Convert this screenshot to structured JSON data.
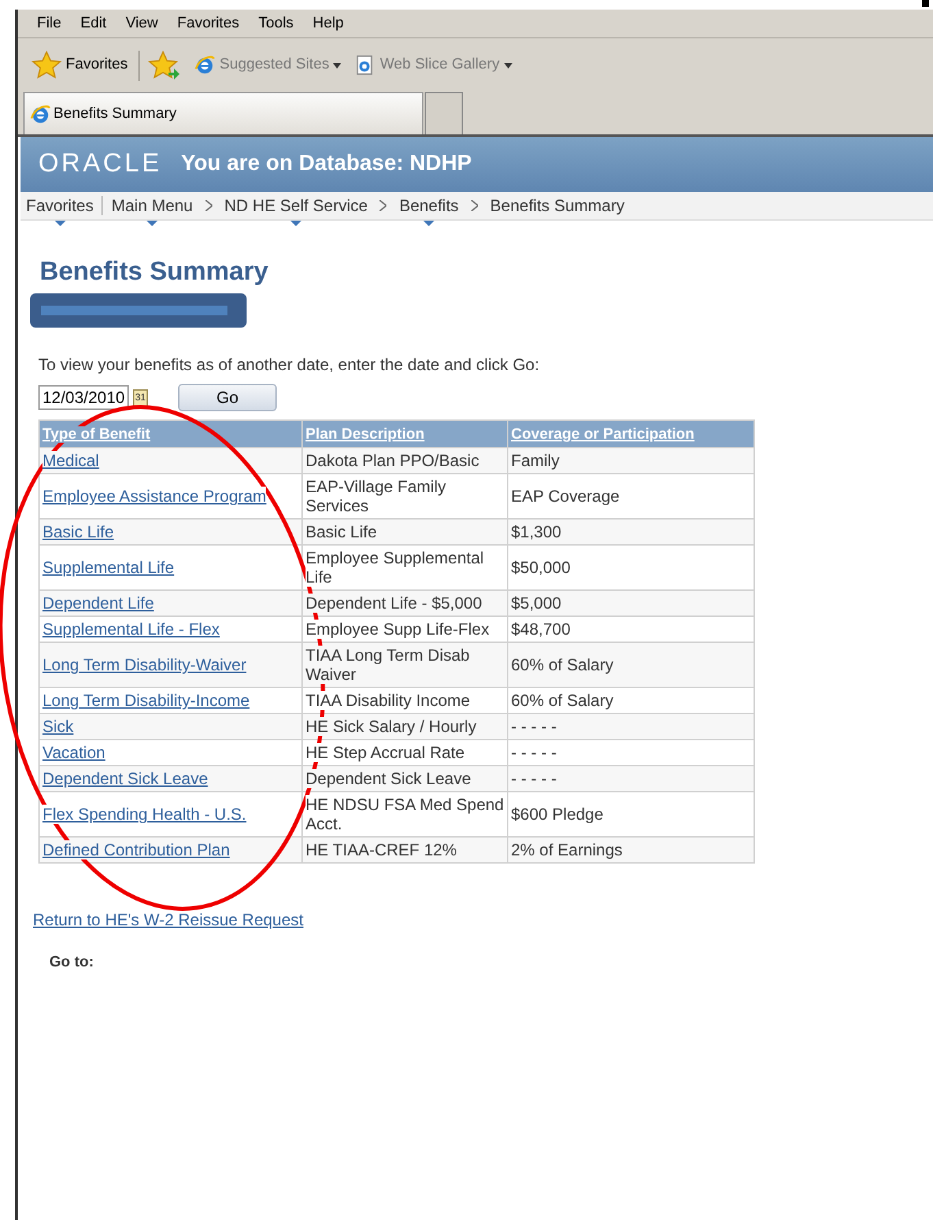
{
  "menu_bar": [
    "File",
    "Edit",
    "View",
    "Favorites",
    "Tools",
    "Help"
  ],
  "favorites_bar": {
    "favorites": "Favorites",
    "links": [
      {
        "label": "Suggested Sites",
        "kind": "ie"
      },
      {
        "label": "Web Slice Gallery",
        "kind": "page"
      }
    ]
  },
  "tab": {
    "title": "Benefits Summary"
  },
  "banner": {
    "logo": "ORACLE",
    "title": "You are on Database: NDHP"
  },
  "breadcrumb": [
    {
      "label": "Favorites",
      "dropdown": true
    },
    {
      "label": "Main Menu",
      "dropdown": true
    },
    {
      "label": "ND HE Self Service",
      "dropdown": true
    },
    {
      "label": "Benefits",
      "dropdown": true
    },
    {
      "label": "Benefits Summary",
      "dropdown": false
    }
  ],
  "page_title": "Benefits Summary",
  "instructions": "To view your benefits as of another date, enter the date and click Go:",
  "date_field": {
    "value": "12/03/2010",
    "calendar_icon": "31"
  },
  "go_button": "Go",
  "table": {
    "columns": [
      "Type of Benefit",
      "Plan Description",
      "Coverage or Participation"
    ],
    "rows": [
      {
        "type": "Medical",
        "plan": "Dakota Plan PPO/Basic",
        "coverage": "Family"
      },
      {
        "type": "Employee Assistance Program",
        "plan": "EAP-Village Family Services",
        "coverage": "EAP Coverage"
      },
      {
        "type": "Basic Life",
        "plan": "Basic Life",
        "coverage": "$1,300"
      },
      {
        "type": "Supplemental Life",
        "plan": "Employee Supplemental Life",
        "coverage": "$50,000"
      },
      {
        "type": "Dependent Life",
        "plan": "Dependent Life - $5,000",
        "coverage": "$5,000"
      },
      {
        "type": "Supplemental Life - Flex",
        "plan": "Employee Supp Life-Flex",
        "coverage": "$48,700"
      },
      {
        "type": "Long Term Disability-Waiver",
        "plan": "TIAA Long Term Disab Waiver",
        "coverage": "60% of Salary"
      },
      {
        "type": "Long Term Disability-Income",
        "plan": "TIAA Disability Income",
        "coverage": "60% of Salary"
      },
      {
        "type": "Sick",
        "plan": "HE Sick Salary / Hourly",
        "coverage": "- - - - -"
      },
      {
        "type": "Vacation",
        "plan": "HE Step Accrual Rate",
        "coverage": "- - - - -"
      },
      {
        "type": "Dependent Sick Leave",
        "plan": "Dependent Sick Leave",
        "coverage": "- - - - -"
      },
      {
        "type": "Flex Spending Health - U.S.",
        "plan": "HE NDSU FSA Med Spend Acct.",
        "coverage": "$600 Pledge"
      },
      {
        "type": "Defined Contribution Plan",
        "plan": "HE TIAA-CREF 12%",
        "coverage": "2% of Earnings"
      }
    ]
  },
  "return_link": "Return to HE's W-2 Reissue Request",
  "go_to_label": "Go to:"
}
